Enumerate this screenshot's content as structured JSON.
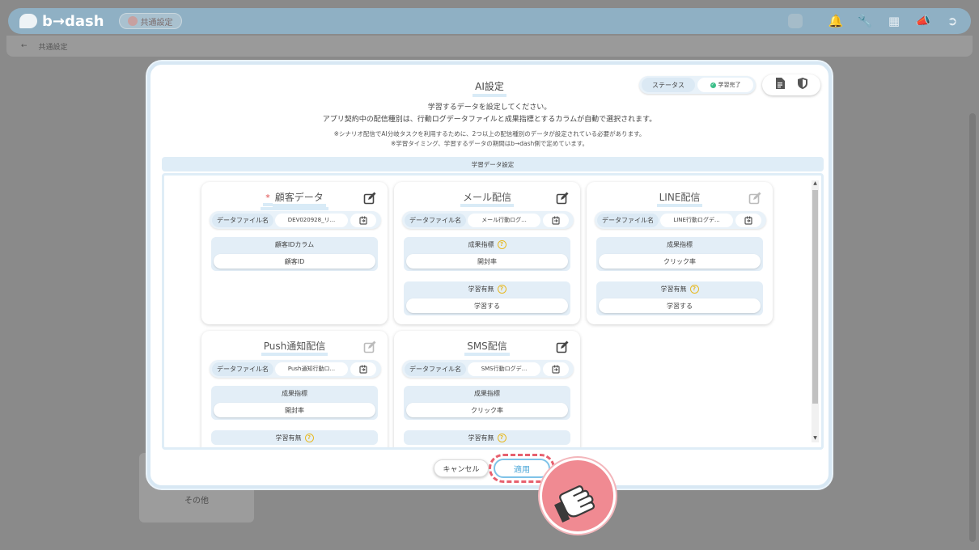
{
  "app": {
    "logo_text": "b→dash",
    "common_badge": "共通設定",
    "breadcrumb": "共通設定",
    "side_item": "その他"
  },
  "modal": {
    "title": "AI設定",
    "status": {
      "label": "ステータス",
      "value": "学習完了"
    },
    "description": [
      "学習するデータを設定してください。",
      "アプリ契約中の配信種別は、行動ログデータファイルと成果指標とするカラムが自動で選択されます。"
    ],
    "notes": [
      "※シナリオ配信でAI分岐タスクを利用するために、2つ以上の配信種別のデータが設定されている必要があります。",
      "※学習タイミング、学習するデータの期間はb→dash側で定めています。"
    ],
    "section_title": "学習データ設定",
    "cards": [
      {
        "title": "顧客データ",
        "required_mark": "*",
        "file_label": "データファイル名",
        "file_name": "DEV020928_リ...",
        "fields": [
          {
            "label": "顧客IDカラム",
            "value": "顧客ID"
          }
        ]
      },
      {
        "title": "メール配信",
        "file_label": "データファイル名",
        "file_name": "メール行動ログ...",
        "fields": [
          {
            "label": "成果指標",
            "value": "開封率"
          },
          {
            "label": "学習有無",
            "value": "学習する"
          }
        ]
      },
      {
        "title": "LINE配信",
        "file_label": "データファイル名",
        "file_name": "LINE行動ログデ...",
        "fields": [
          {
            "label": "成果指標",
            "value": "クリック率"
          },
          {
            "label": "学習有無",
            "value": "学習する"
          }
        ]
      },
      {
        "title": "Push通知配信",
        "file_label": "データファイル名",
        "file_name": "Push通知行動ロ...",
        "fields": [
          {
            "label": "成果指標",
            "value": "開封率"
          },
          {
            "label": "学習有無",
            "value": ""
          }
        ]
      },
      {
        "title": "SMS配信",
        "file_label": "データファイル名",
        "file_name": "SMS行動ログデ...",
        "fields": [
          {
            "label": "成果指標",
            "value": "クリック率"
          },
          {
            "label": "学習有無",
            "value": ""
          }
        ]
      }
    ],
    "buttons": {
      "cancel": "キャンセル",
      "apply": "適用"
    }
  },
  "colors": {
    "accent": "#7fc3e8",
    "highlight": "#e7606e",
    "status_ok": "#3cbf8a",
    "help_icon": "#e7b923",
    "required": "#e04c4c"
  },
  "icons": [
    "bell-icon",
    "wrench-icon",
    "grid-icon",
    "megaphone-icon",
    "logout-icon",
    "document-icon",
    "shield-icon",
    "edit-icon",
    "refresh-file-icon",
    "question-icon",
    "hand-pointer-icon",
    "back-arrow-icon"
  ]
}
